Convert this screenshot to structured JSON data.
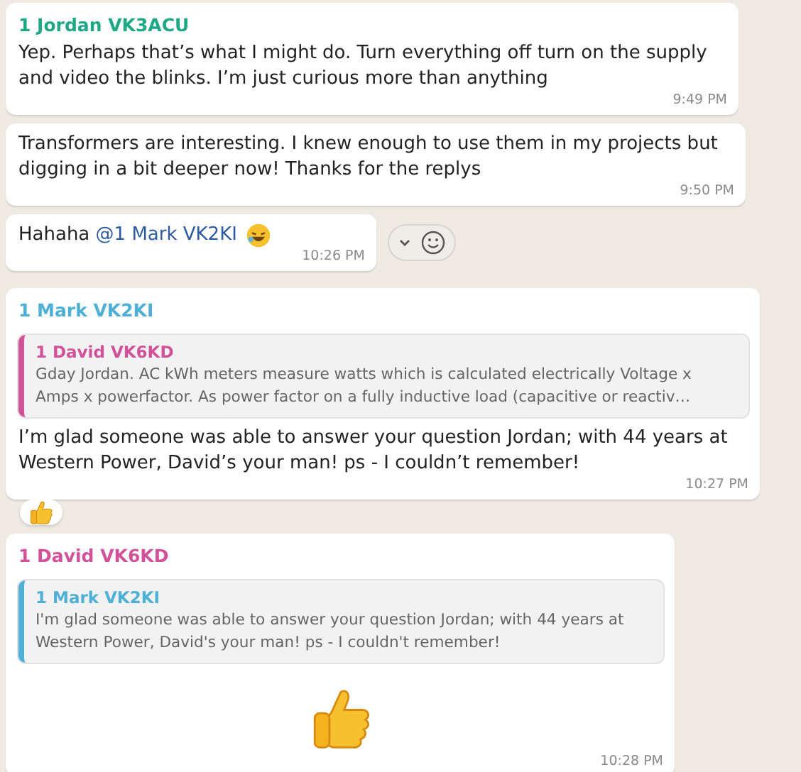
{
  "messages": [
    {
      "kind": "text",
      "sender": {
        "name": "1 Jordan VK3ACU",
        "color": "#1fa886"
      },
      "text": "Yep. Perhaps that’s what I might do. Turn everything off turn on the supply and video the blinks. I’m just curious more than anything",
      "time": "9:49 PM",
      "reacted": false,
      "hover_actions": false
    },
    {
      "kind": "text",
      "text": "Transformers are interesting. I knew enough to use them in my projects but digging in a bit deeper now! Thanks for the replys",
      "time": "9:50 PM",
      "reacted": false,
      "hover_actions": false
    },
    {
      "kind": "mention",
      "text": "Hahaha",
      "mention": "@1 Mark VK2KI",
      "time": "10:26 PM",
      "reacted": false,
      "hover_actions": true
    },
    {
      "kind": "text",
      "sender": {
        "name": "1 Mark VK2KI",
        "color": "#4fb0d6"
      },
      "quote": {
        "sender": {
          "name": "1 David VK6KD",
          "color": "#d2529a"
        },
        "text": "Gday Jordan. AC kWh meters measure watts which is calculated electrically Voltage x Amps x powerfactor.  As power factor on a fully inductive load (capacitive or reactiv…"
      },
      "text": "I’m glad someone was able to answer your question Jordan;  with 44 years at Western Power, David’s your man!  ps - I couldn’t remember!",
      "time": "10:27 PM",
      "reacted": true,
      "hover_actions": false
    },
    {
      "kind": "sticker",
      "sender": {
        "name": "1 David VK6KD",
        "color": "#d2529a"
      },
      "quote": {
        "sender": {
          "name": "1 Mark VK2KI",
          "color": "#4fb0d6"
        },
        "text": "I'm glad someone was able to answer your question Jordan;  with 44 years at Western Power, David's your man!  ps - I couldn't remember!"
      },
      "time": "10:28 PM",
      "reacted": false,
      "hover_actions": false
    }
  ]
}
